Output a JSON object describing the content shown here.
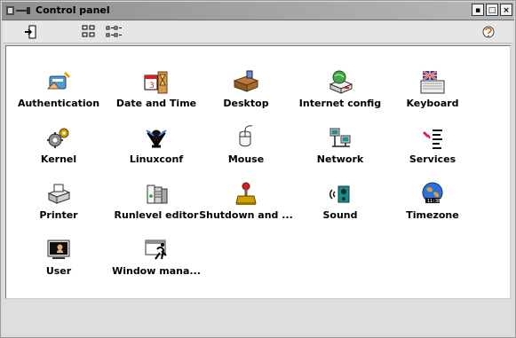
{
  "window": {
    "title": "Control panel",
    "controls": [
      "minimize",
      "maximize",
      "close"
    ]
  },
  "toolbar": {
    "buttons": [
      {
        "icon": "exit-icon"
      },
      {
        "icon": "large-icons-view-icon"
      },
      {
        "icon": "small-icons-view-icon"
      },
      {
        "icon": "help-icon"
      }
    ]
  },
  "items": [
    {
      "label": "Authentication",
      "icon": "authentication-icon"
    },
    {
      "label": "Date and Time",
      "icon": "date-time-icon"
    },
    {
      "label": "Desktop",
      "icon": "desktop-icon"
    },
    {
      "label": "Internet config",
      "icon": "internet-config-icon"
    },
    {
      "label": "Keyboard",
      "icon": "keyboard-icon"
    },
    {
      "label": "Kernel",
      "icon": "kernel-icon"
    },
    {
      "label": "Linuxconf",
      "icon": "linuxconf-icon"
    },
    {
      "label": "Mouse",
      "icon": "mouse-icon"
    },
    {
      "label": "Network",
      "icon": "network-icon"
    },
    {
      "label": "Services",
      "icon": "services-icon"
    },
    {
      "label": "Printer",
      "icon": "printer-icon"
    },
    {
      "label": "Runlevel editor",
      "icon": "runlevel-editor-icon"
    },
    {
      "label": "Shutdown and ...",
      "icon": "shutdown-icon"
    },
    {
      "label": "Sound",
      "icon": "sound-icon"
    },
    {
      "label": "Timezone",
      "icon": "timezone-icon"
    },
    {
      "label": "User",
      "icon": "user-icon"
    },
    {
      "label": "Window mana...",
      "icon": "window-manager-icon"
    }
  ]
}
